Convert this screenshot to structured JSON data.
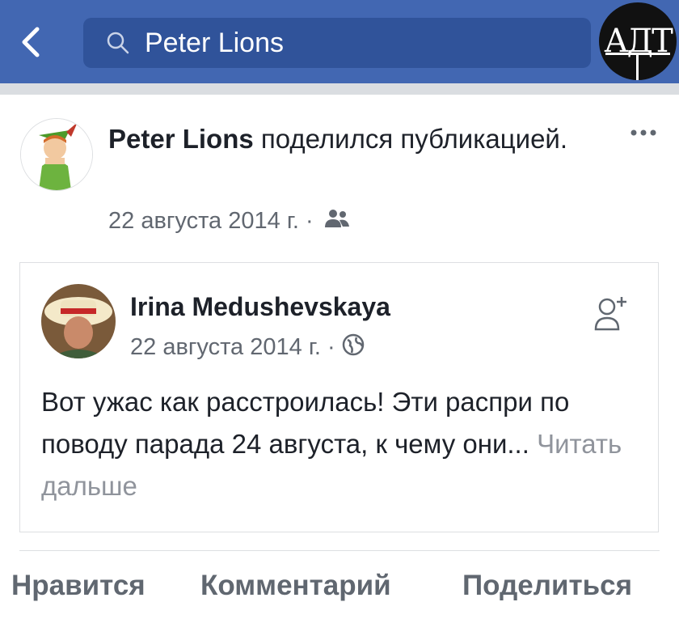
{
  "search": {
    "query": "Peter Lions"
  },
  "watermark": {
    "text": "АДТ"
  },
  "post": {
    "author": "Peter Lions",
    "action": "поделился публикацией.",
    "date": "22 августа 2014 г.",
    "separator": "·",
    "audience_icon": "friends-icon"
  },
  "shared": {
    "author": "Irina Medushevskaya",
    "date": "22 августа 2014 г.",
    "separator": "·",
    "audience_icon": "globe-icon",
    "text": "Вот ужас как расстроилась! Эти распри по поводу парада 24 августа, к чему они...",
    "more_label": "Читать дальше"
  },
  "actions": {
    "like": "Нравится",
    "comment": "Комментарий",
    "share": "Поделиться"
  },
  "colors": {
    "brand_blue": "#4267b2",
    "search_bg": "#30539a",
    "meta_gray": "#616770",
    "more_gray": "#90949c"
  }
}
